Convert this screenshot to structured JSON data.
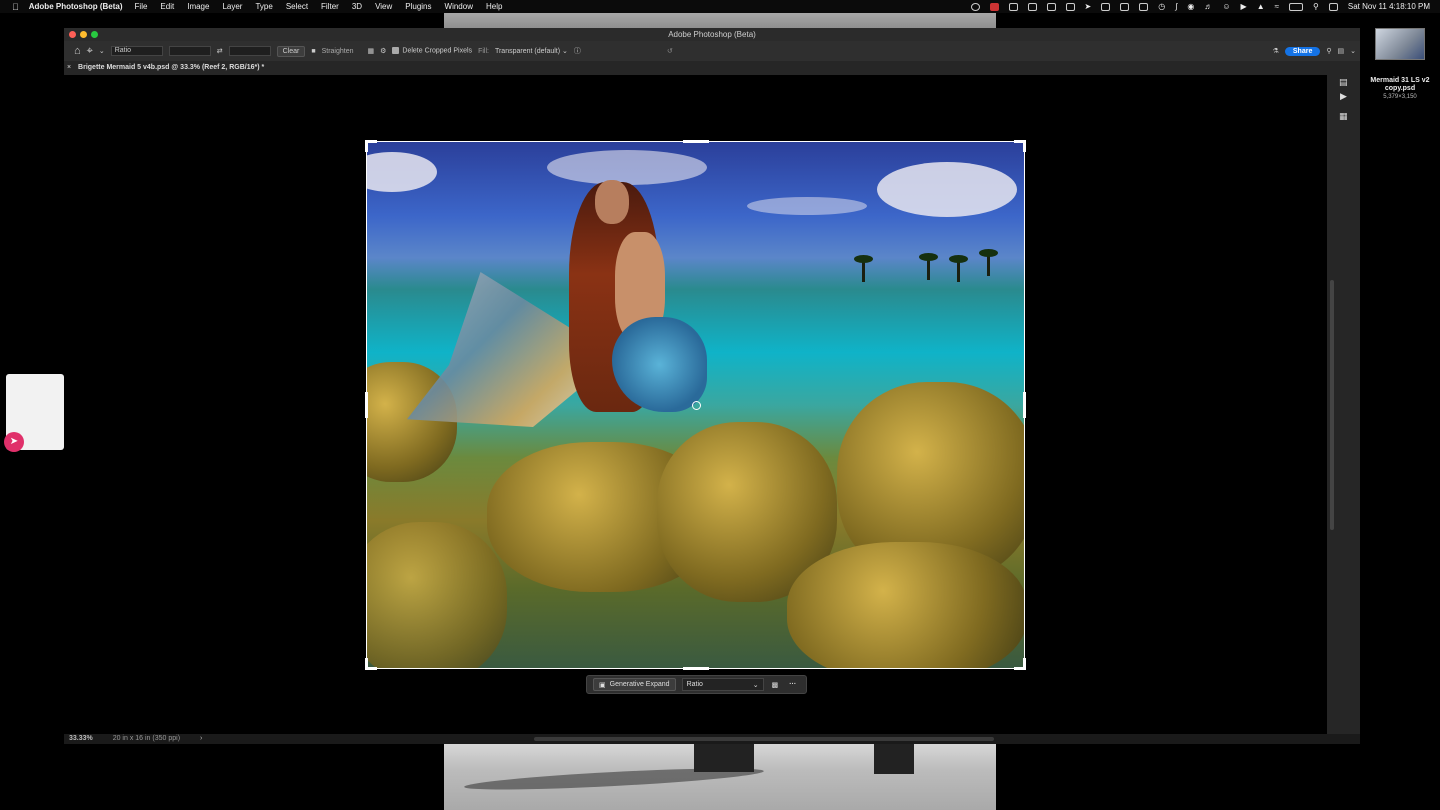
{
  "menubar": {
    "app_name": "Adobe Photoshop (Beta)",
    "items": [
      "File",
      "Edit",
      "Image",
      "Layer",
      "Type",
      "Select",
      "Filter",
      "3D",
      "View",
      "Plugins",
      "Window",
      "Help"
    ],
    "clock": "Sat Nov 11  4:18:10 PM"
  },
  "window": {
    "title": "Adobe Photoshop (Beta)"
  },
  "options_bar": {
    "ratio_select": "Ratio",
    "width_value": "",
    "height_value": "",
    "clear_label": "Clear",
    "straighten_label": "Straighten",
    "delete_cropped_label": "Delete Cropped Pixels",
    "fill_label": "Fill:",
    "fill_value": "Transparent (default)",
    "share_label": "Share"
  },
  "doc_tab": {
    "title": "Brigette   Mermaid   5 v4b.psd @ 33.3% (Reef 2, RGB/16*) *"
  },
  "contextual_bar": {
    "generative_expand_label": "Generative Expand",
    "ratio_value": "Ratio",
    "more_label": "···"
  },
  "status_bar": {
    "zoom": "33.33%",
    "doc_size": "20 in x 16 in (350 ppi)"
  },
  "desktop_file": {
    "name": "Mermaid 31 LS v2 copy.psd",
    "dims": "5,379×3,150"
  },
  "colors": {
    "share_button": "#1473e6",
    "close_light": "#ff5f57",
    "min_light": "#febc2e",
    "max_light": "#28c840",
    "accent_badge": "#e0306a"
  }
}
